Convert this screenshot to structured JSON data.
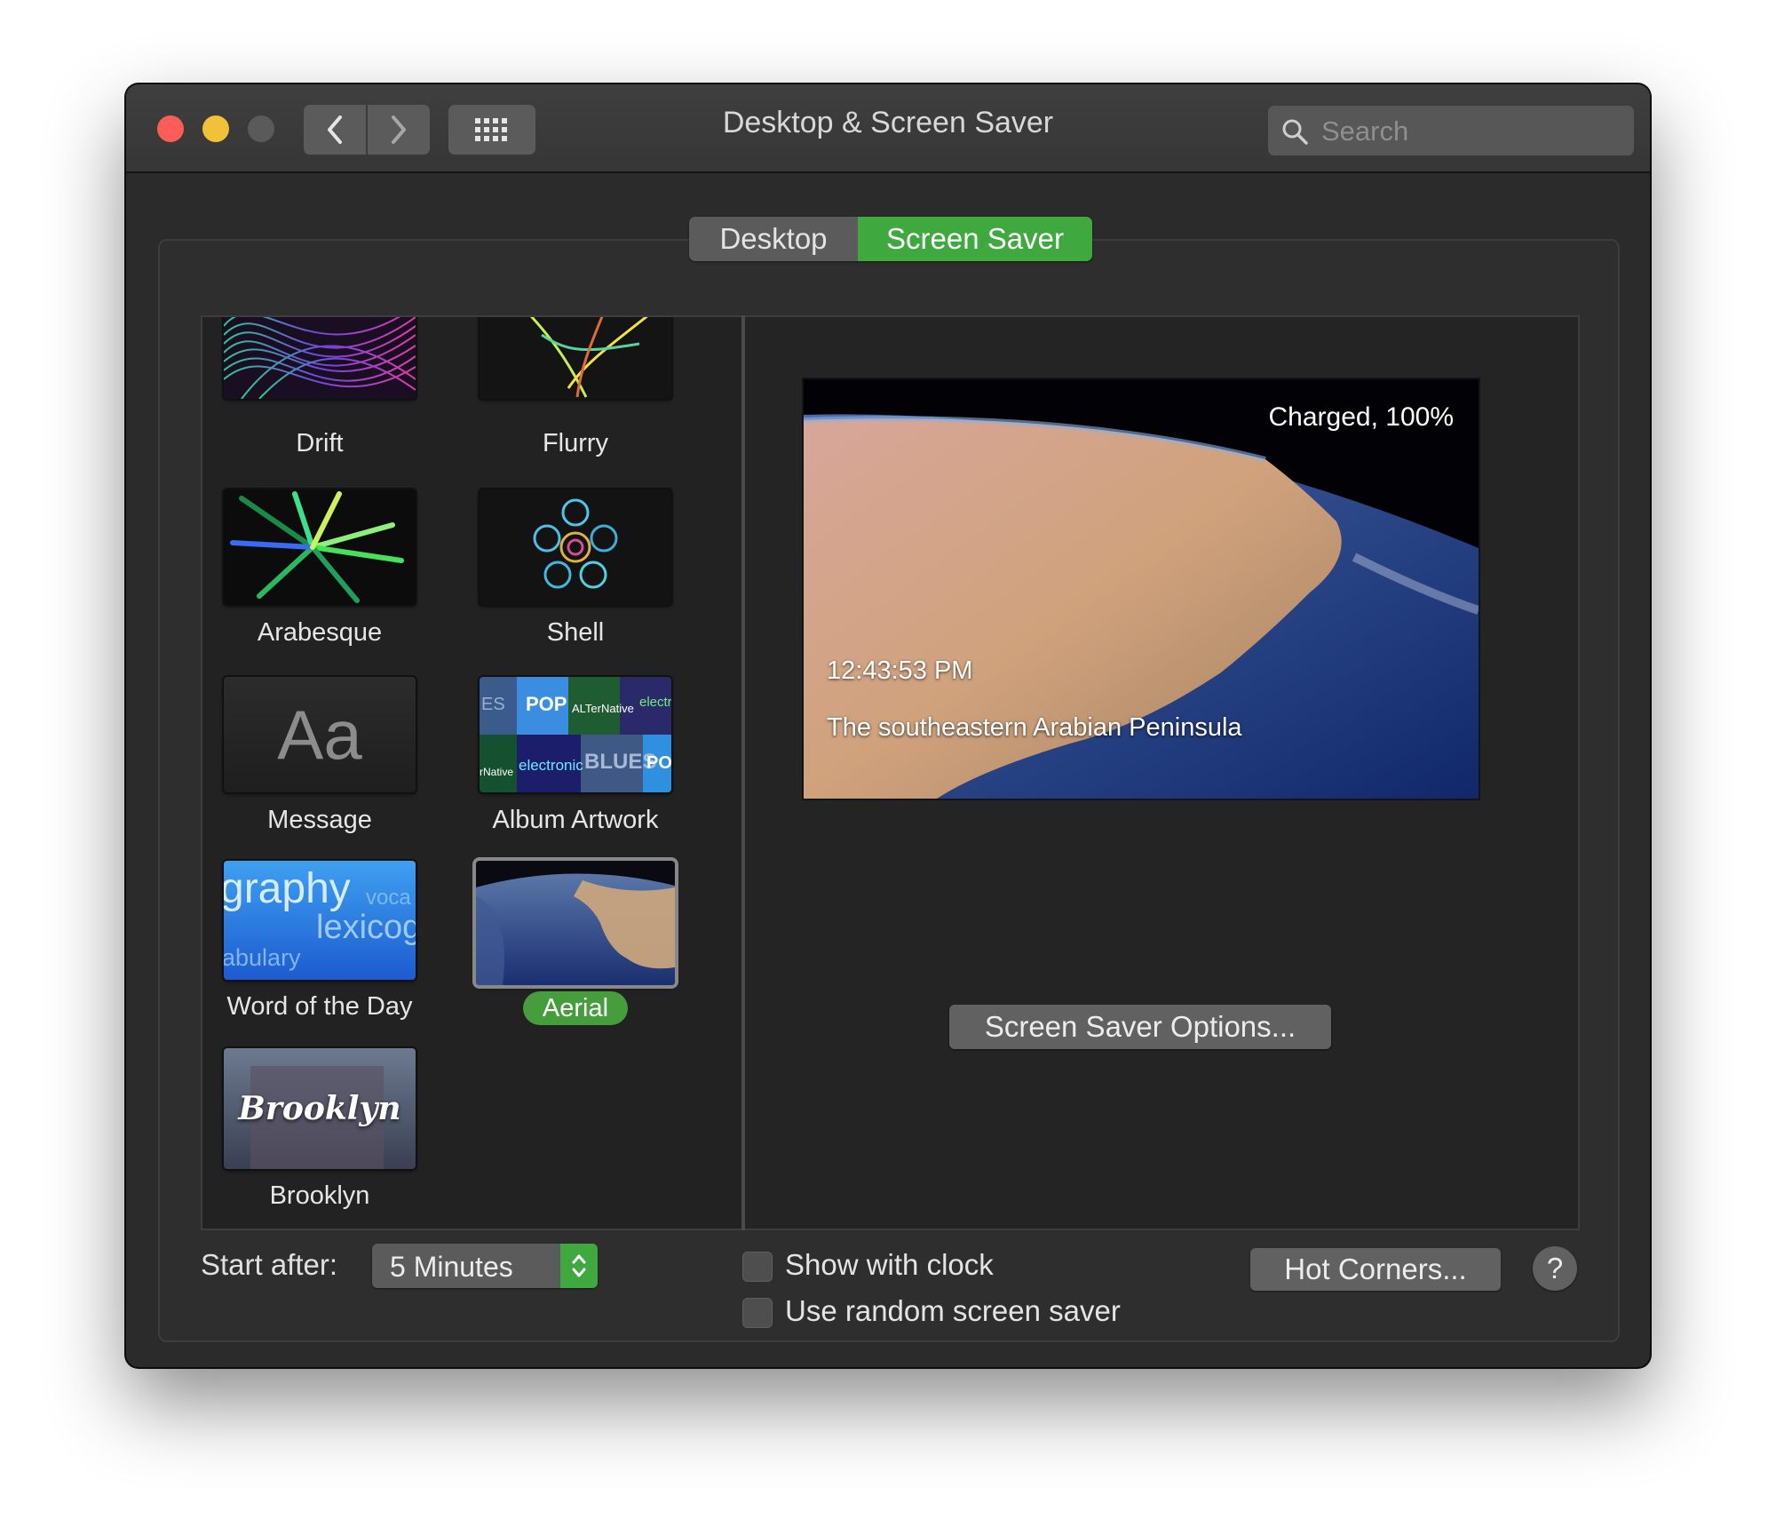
{
  "window": {
    "title": "Desktop & Screen Saver"
  },
  "search": {
    "placeholder": "Search"
  },
  "tabs": [
    {
      "label": "Desktop"
    },
    {
      "label": "Screen Saver",
      "selected": true
    }
  ],
  "screen_savers": [
    {
      "label": "Drift"
    },
    {
      "label": "Flurry"
    },
    {
      "label": "Arabesque"
    },
    {
      "label": "Shell"
    },
    {
      "label": "Message",
      "thumb_text": "Aa"
    },
    {
      "label": "Album Artwork",
      "thumb_words": [
        "ES",
        "POP",
        "ALTerNative",
        "electr",
        "rNative",
        "electronic",
        "BLUES",
        "PO"
      ]
    },
    {
      "label": "Word of the Day",
      "thumb_words": [
        "graphy",
        "voca",
        "lexicog",
        "abulary"
      ]
    },
    {
      "label": "Aerial",
      "selected": true
    },
    {
      "label": "Brooklyn",
      "thumb_text": "Brooklyn"
    }
  ],
  "preview": {
    "battery_status": "Charged, 100%",
    "clock_time": "12:43:53 PM",
    "caption": "The southeastern Arabian Peninsula"
  },
  "options_button": "Screen Saver Options...",
  "start_after": {
    "label": "Start after:",
    "value": "5 Minutes"
  },
  "checkboxes": [
    {
      "label": "Show with clock",
      "checked": false
    },
    {
      "label": "Use random screen saver",
      "checked": false
    }
  ],
  "hot_corners_button": "Hot Corners...",
  "help_button": "?",
  "colors": {
    "accent": "#3fa940",
    "window_bg": "#2b2b2c",
    "close": "#fc5e57",
    "minimize": "#f2c13a"
  }
}
